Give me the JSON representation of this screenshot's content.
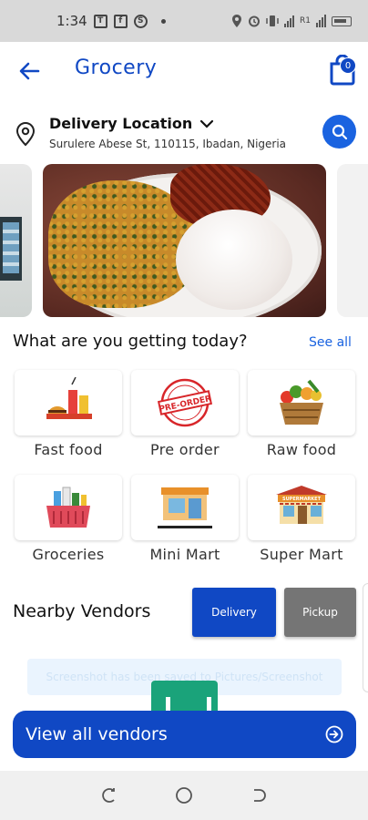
{
  "status_bar": {
    "time": "1:34",
    "icons": [
      "t-app-icon",
      "facebook-icon",
      "settings-s-icon",
      "location-icon",
      "alarm-icon",
      "vibrate-icon",
      "signal-icon",
      "wifi-icon",
      "battery-icon"
    ],
    "sim_label": "R1"
  },
  "header": {
    "title": "Grocery",
    "cart_count": "0"
  },
  "location": {
    "title": "Delivery Location",
    "address": "Surulere Abese St, 110115, Ibadan, Nigeria"
  },
  "categories_section": {
    "title": "What are you getting today?",
    "see_all": "See all"
  },
  "categories": [
    {
      "label": "Fast food",
      "icon": "fast-food-icon"
    },
    {
      "label": "Pre order",
      "icon": "pre-order-stamp-icon",
      "stamp_text": "PRE-ORDER"
    },
    {
      "label": "Raw food",
      "icon": "vegetable-basket-icon"
    },
    {
      "label": "Groceries",
      "icon": "grocery-basket-icon"
    },
    {
      "label": "Mini Mart",
      "icon": "mini-mart-icon"
    },
    {
      "label": "Super Mart",
      "icon": "super-mart-icon",
      "sign_text": "SUPERMARKET"
    }
  ],
  "nearby": {
    "title": "Nearby Vendors",
    "tab_delivery": "Delivery",
    "tab_pickup": "Pickup"
  },
  "toast": "Screenshot has been saved to Pictures/Screenshot",
  "view_all": {
    "label": "View all vendors"
  },
  "colors": {
    "primary": "#1048c4",
    "accent": "#1a63e0",
    "inactive_tab": "#757575"
  }
}
